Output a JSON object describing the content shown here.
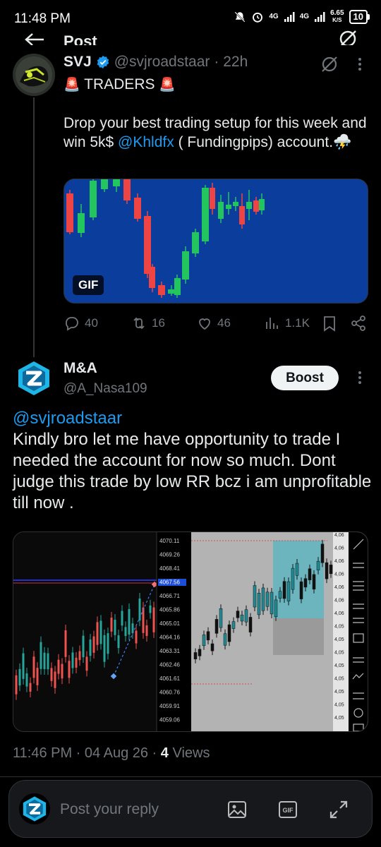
{
  "status_bar": {
    "time": "11:48 PM",
    "net1": "4G",
    "net2": "4G",
    "speed_value": "6.65",
    "speed_unit": "K/S",
    "battery": "10"
  },
  "header": {
    "title": "Post"
  },
  "tweet1": {
    "name": "SVJ",
    "handle": "@svjroadstaar",
    "time": "· 22h",
    "heading_emoji_left": "🚨",
    "heading": "TRADERS",
    "heading_emoji_right": "🚨",
    "body_before_mention": "Drop your best trading setup for this week and win 5k$",
    "mention": "@Khldfx",
    "body_after_mention": "( Fundingpips) account.",
    "body_emoji": "⛈️",
    "media_badge": "GIF",
    "replies": "40",
    "reposts": "16",
    "likes": "46",
    "views": "1.1K"
  },
  "tweet2": {
    "name": "M&A",
    "handle": "@A_Nasa109",
    "boost_label": "Boost",
    "mention": "@svjroadstaar",
    "body": "Kindly bro let me have opportunity to trade I needed the account for now so much. Dont judge this trade by low RR bcz i am unprofitable till now .",
    "price_labels": [
      "4070.11",
      "4069.26",
      "4068.41",
      "4067.56",
      "4066.71",
      "4065.86",
      "4065.01",
      "4064.16",
      "4063.31",
      "4062.46",
      "4061.61",
      "4060.76",
      "4059.91",
      "4059.06"
    ],
    "right_panel_labels": [
      "4,06",
      "4,06",
      "4,06",
      "4,06",
      "4,06",
      "4,06",
      "4,06",
      "4,05",
      "4,05",
      "4,05",
      "4,05",
      "4,05",
      "4,05",
      "4,05",
      "4,05"
    ],
    "meta_time": "11:46 PM",
    "meta_date": "04 Aug 26",
    "meta_views_count": "4",
    "meta_views_label": "Views"
  },
  "reply": {
    "placeholder": "Post your reply"
  },
  "colors": {
    "background": "#000000",
    "accent": "#1d9bf0",
    "muted": "#71767b",
    "candle_up": "#22c55e",
    "candle_down": "#ef4444",
    "chart_bg_blue": "#0b3d9c"
  }
}
